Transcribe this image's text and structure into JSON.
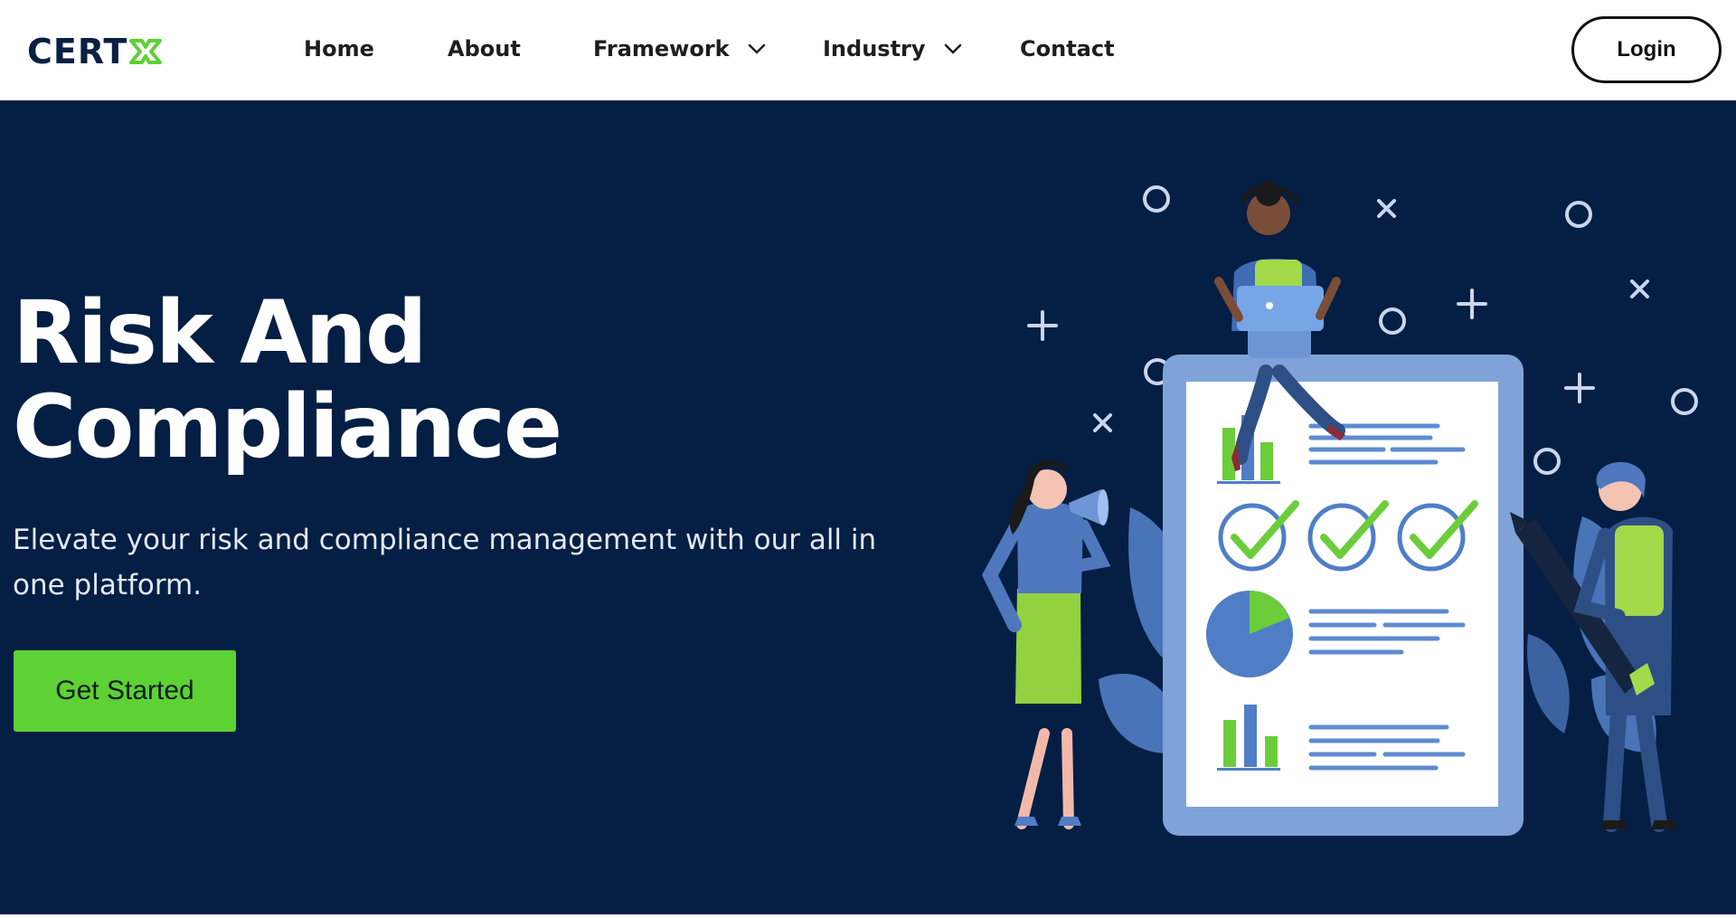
{
  "brand": {
    "logo_text": "CERT",
    "logo_x_icon": "x-mark-icon",
    "logo_color": "#0a1f44",
    "accent": "#5cd234"
  },
  "nav": {
    "items": [
      {
        "label": "Home",
        "has_dropdown": false
      },
      {
        "label": "About",
        "has_dropdown": false
      },
      {
        "label": "Framework",
        "has_dropdown": true
      },
      {
        "label": "Industry",
        "has_dropdown": true
      },
      {
        "label": "Contact",
        "has_dropdown": false
      }
    ],
    "login_label": "Login"
  },
  "hero": {
    "title_line1": "Risk And",
    "title_line2": "Compliance",
    "subtitle": "Elevate your risk and compliance management with our all in one platform.",
    "cta_label": "Get Started",
    "background": "#041e44",
    "illustration": {
      "icons": [
        "checklist-board-illustration",
        "woman-with-laptop-illustration",
        "woman-with-megaphone-illustration",
        "man-with-pencil-illustration",
        "checkmark-icon",
        "pie-chart-icon",
        "bar-chart-icon"
      ]
    }
  }
}
